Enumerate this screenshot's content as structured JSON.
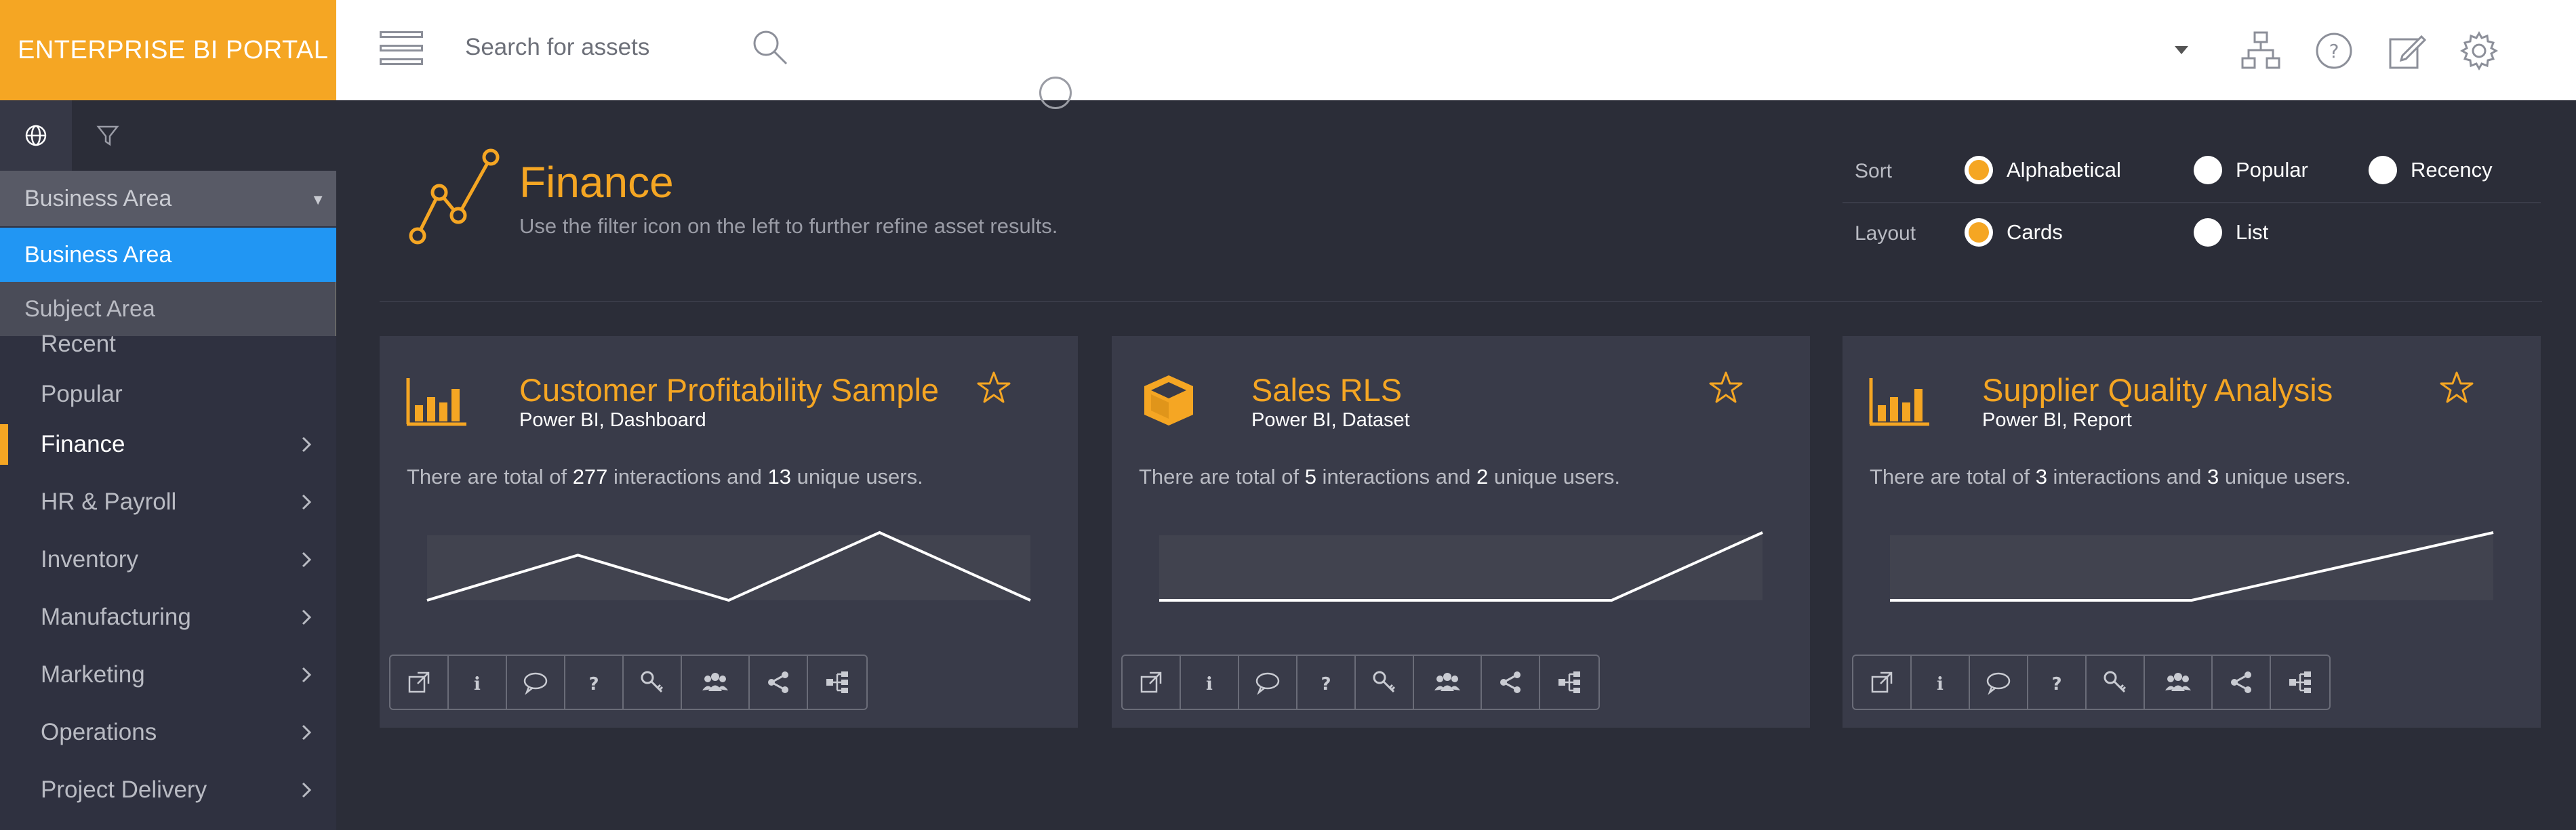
{
  "brand": {
    "title": "ENTERPRISE BI PORTAL"
  },
  "search": {
    "placeholder": "Search for assets"
  },
  "colors": {
    "accent": "#f5a623",
    "selected": "#2196f3",
    "background": "#2b2d38",
    "card": "#393b49"
  },
  "header_icons": [
    "hierarchy-icon",
    "help-icon",
    "edit-icon",
    "settings-icon"
  ],
  "sidebar": {
    "tabs": [
      "globe-icon",
      "filter-icon"
    ],
    "dropdown": {
      "selected": "Business Area",
      "options": [
        "Business Area",
        "Subject Area"
      ]
    },
    "items": [
      {
        "label": "Recent",
        "chevron": false
      },
      {
        "label": "Popular",
        "chevron": false
      },
      {
        "label": "Finance",
        "chevron": true,
        "active": true
      },
      {
        "label": "HR & Payroll",
        "chevron": true
      },
      {
        "label": "Inventory",
        "chevron": true
      },
      {
        "label": "Manufacturing",
        "chevron": true
      },
      {
        "label": "Marketing",
        "chevron": true
      },
      {
        "label": "Operations",
        "chevron": true
      },
      {
        "label": "Project Delivery",
        "chevron": true
      }
    ]
  },
  "main": {
    "title": "Finance",
    "subtitle": "Use the filter icon on the left to further refine asset results.",
    "sort": {
      "label": "Sort",
      "options": [
        "Alphabetical",
        "Popular",
        "Recency"
      ],
      "selected": "Alphabetical"
    },
    "layout": {
      "label": "Layout",
      "options": [
        "Cards",
        "List"
      ],
      "selected": "Cards"
    }
  },
  "cards": [
    {
      "title": "Customer Profitability Sample",
      "subtitle": "Power BI, Dashboard",
      "icon": "bar-chart-icon",
      "desc_prefix": "There are total of ",
      "interactions": "277",
      "desc_mid": " interactions and ",
      "users": "13",
      "desc_suffix": " unique users.",
      "trend": [
        1,
        3,
        1,
        4,
        1
      ]
    },
    {
      "title": "Sales RLS",
      "subtitle": "Power BI, Dataset",
      "icon": "cube-icon",
      "desc_prefix": "There are total of ",
      "interactions": "5",
      "desc_mid": " interactions and ",
      "users": "2",
      "desc_suffix": " unique users.",
      "trend": [
        1,
        1,
        1,
        1,
        4
      ]
    },
    {
      "title": "Supplier Quality Analysis",
      "subtitle": "Power BI, Report",
      "icon": "bar-chart-icon",
      "desc_prefix": "There are total of ",
      "interactions": "3",
      "desc_mid": " interactions and ",
      "users": "3",
      "desc_suffix": " unique users.",
      "trend": [
        1,
        1,
        1,
        2.5,
        4
      ]
    }
  ],
  "card_actions": [
    "open-external-icon",
    "info-icon",
    "comment-icon",
    "help-icon",
    "key-icon",
    "users-icon",
    "share-icon",
    "lineage-icon"
  ]
}
